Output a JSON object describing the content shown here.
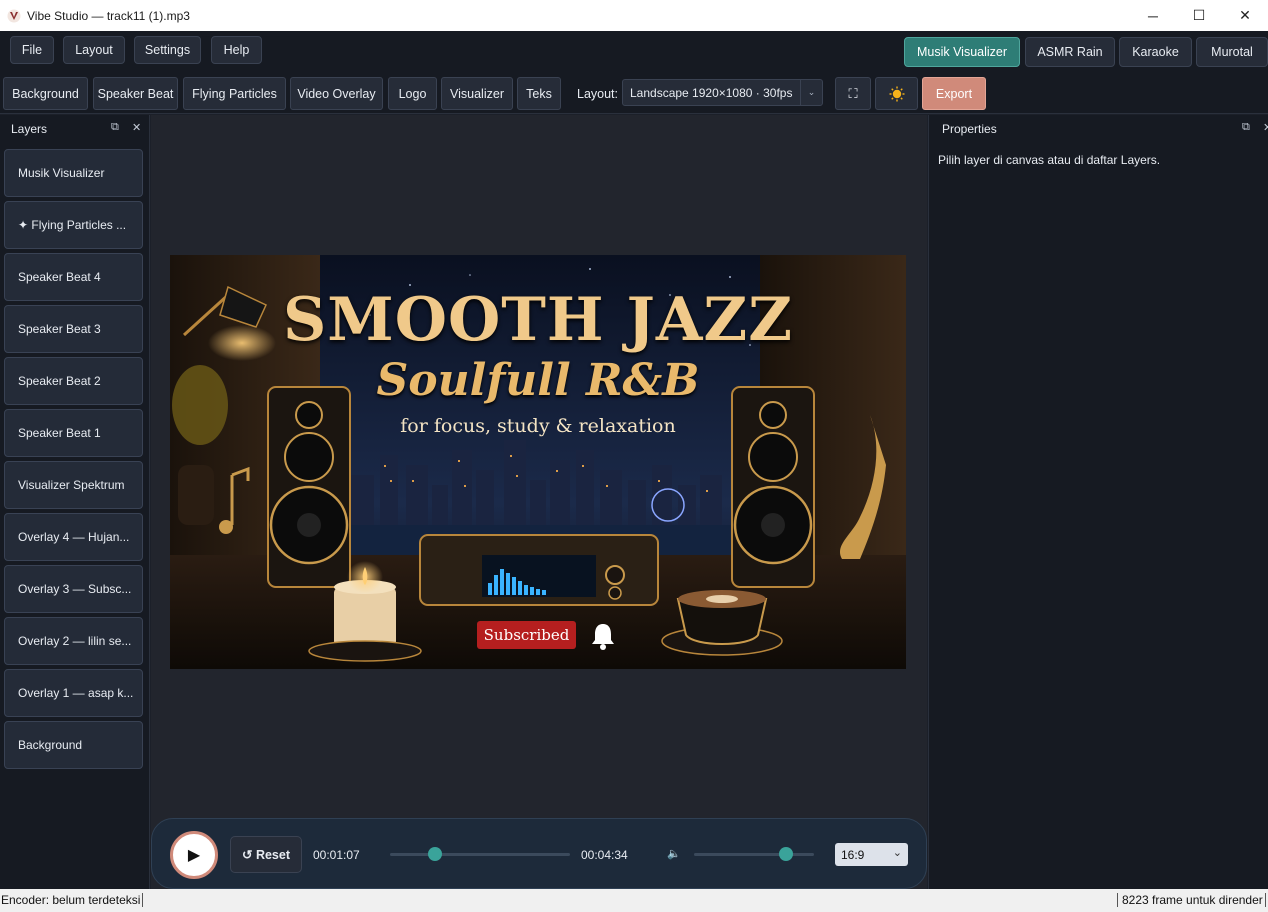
{
  "window": {
    "title": "Vibe Studio — track11 (1).mp3",
    "controls": {
      "minimize": "─",
      "maximize": "☐",
      "close": "✕"
    }
  },
  "menu": [
    "File",
    "Layout",
    "Settings",
    "Help"
  ],
  "modes": {
    "items": [
      "Musik Visualizer",
      "ASMR Rain",
      "Karaoke",
      "Murotal"
    ],
    "active": "Musik Visualizer",
    "active_color": "#2e7d76"
  },
  "toolbar": {
    "buttons": [
      "Background",
      "Speaker Beat",
      "Flying Particles",
      "Video Overlay",
      "Logo",
      "Visualizer",
      "Teks"
    ],
    "layout_label": "Layout:",
    "layout_value": "Landscape 1920×1080 · 30fps",
    "fullscreen_icon": "⛶",
    "theme_icon": "sun-icon",
    "export_label": "Export",
    "export_color": "#d08a7a"
  },
  "layers": {
    "title": "Layers",
    "items": [
      "Musik Visualizer",
      "✦ Flying Particles ...",
      "Speaker Beat 4",
      "Speaker Beat 3",
      "Speaker Beat 2",
      "Speaker Beat 1",
      "Visualizer Spektrum",
      "Overlay 4 — Hujan...",
      "Overlay 3 — Subsc...",
      "Overlay 2 — lilin se...",
      "Overlay 1 — asap k...",
      "Background"
    ]
  },
  "canvas": {
    "title_line1": "SMOOTH JAZZ",
    "title_line2": "Soulfull R&B",
    "subtitle": "for focus, study & relaxation",
    "subscribe_label": "Subscribed"
  },
  "properties": {
    "title": "Properties",
    "hint": "Pilih layer di canvas atau di daftar Layers."
  },
  "transport": {
    "play_icon": "▶",
    "reset_label": "↺ Reset",
    "current_time": "00:01:07",
    "total_time": "00:04:34",
    "progress": 0.25,
    "volume_icon": "🔈",
    "volume": 0.77,
    "aspect_ratio": "16:9"
  },
  "status": {
    "left": "Encoder: belum terdeteksi",
    "right": "8223 frame untuk dirender"
  }
}
